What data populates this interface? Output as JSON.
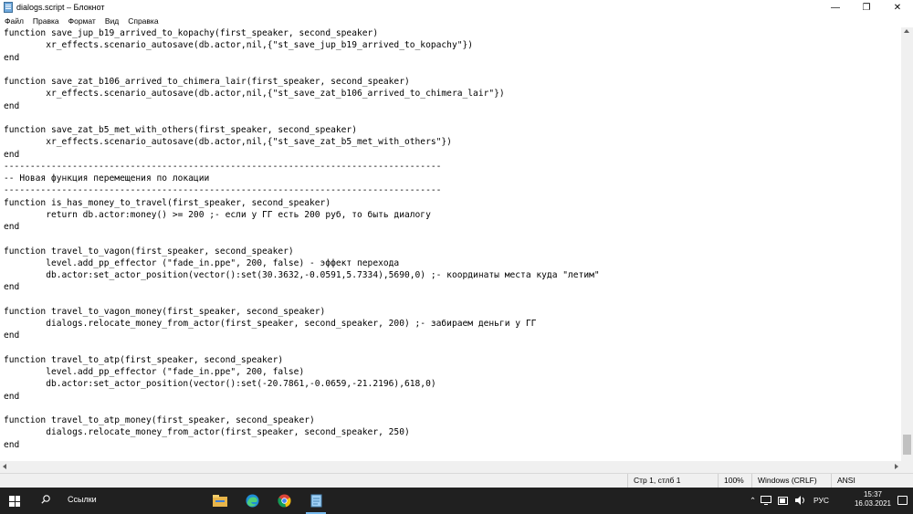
{
  "window": {
    "title": "dialogs.script – Блокнот",
    "minimize_glyph": "—",
    "maximize_glyph": "❐",
    "close_glyph": "✕"
  },
  "menu": {
    "items": [
      "Файл",
      "Правка",
      "Формат",
      "Вид",
      "Справка"
    ]
  },
  "editor": {
    "lines": [
      "function save_jup_b19_arrived_to_kopachy(first_speaker, second_speaker)",
      "        xr_effects.scenario_autosave(db.actor,nil,{\"st_save_jup_b19_arrived_to_kopachy\"})",
      "end",
      "",
      "function save_zat_b106_arrived_to_chimera_lair(first_speaker, second_speaker)",
      "        xr_effects.scenario_autosave(db.actor,nil,{\"st_save_zat_b106_arrived_to_chimera_lair\"})",
      "end",
      "",
      "function save_zat_b5_met_with_others(first_speaker, second_speaker)",
      "        xr_effects.scenario_autosave(db.actor,nil,{\"st_save_zat_b5_met_with_others\"})",
      "end",
      "-----------------------------------------------------------------------------------",
      "-- Новая функция перемещения по локации",
      "-----------------------------------------------------------------------------------",
      "function is_has_money_to_travel(first_speaker, second_speaker)",
      "        return db.actor:money() >= 200 ;- если у ГГ есть 200 руб, то быть диалогу",
      "end",
      "",
      "function travel_to_vagon(first_speaker, second_speaker)",
      "        level.add_pp_effector (\"fade_in.ppe\", 200, false) - эффект перехода",
      "        db.actor:set_actor_position(vector():set(30.3632,-0.0591,5.7334),5690,0) ;- координаты места куда \"летим\"",
      "end",
      "",
      "function travel_to_vagon_money(first_speaker, second_speaker)",
      "        dialogs.relocate_money_from_actor(first_speaker, second_speaker, 200) ;- забираем деньги у ГГ",
      "end",
      "",
      "function travel_to_atp(first_speaker, second_speaker)",
      "        level.add_pp_effector (\"fade_in.ppe\", 200, false)",
      "        db.actor:set_actor_position(vector():set(-20.7861,-0.0659,-21.2196),618,0)",
      "end",
      "",
      "function travel_to_atp_money(first_speaker, second_speaker)",
      "        dialogs.relocate_money_from_actor(first_speaker, second_speaker, 250)",
      "end"
    ]
  },
  "status": {
    "position": "Стр 1, стлб 1",
    "zoom": "100%",
    "line_endings": "Windows (CRLF)",
    "encoding": "ANSI"
  },
  "taskbar": {
    "search_text": "Ссылки",
    "language": "РУС",
    "time": "15:37",
    "date": "16.03.2021",
    "apps": [
      "file-explorer",
      "edge",
      "chrome",
      "notepad"
    ]
  }
}
